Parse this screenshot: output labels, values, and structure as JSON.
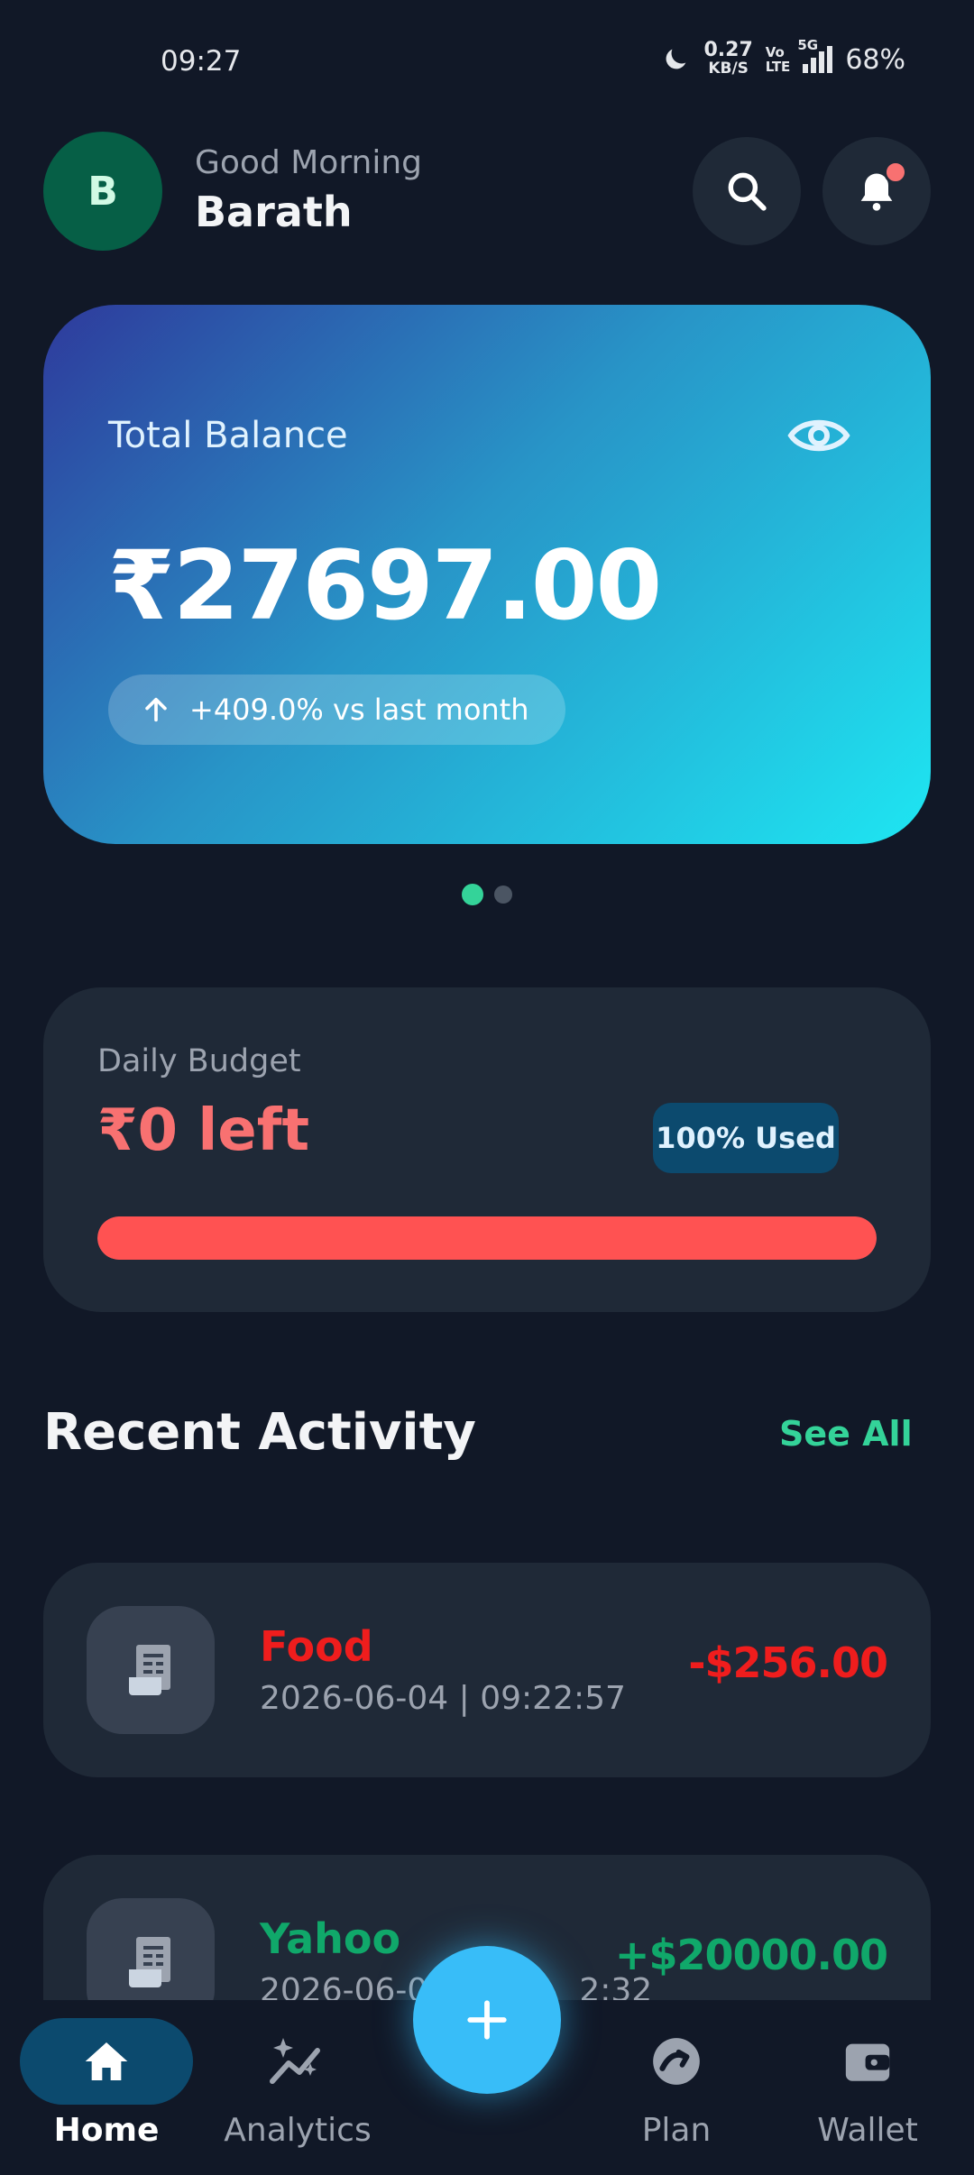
{
  "status_bar": {
    "time": "09:27",
    "net_speed": "0.27",
    "net_speed_unit": "KB/S",
    "volte_top": "Vo",
    "volte_bottom": "LTE",
    "network": "5G",
    "battery": "68%"
  },
  "header": {
    "avatar_initial": "B",
    "greeting": "Good Morning",
    "user_name": "Barath",
    "has_notification": true
  },
  "balance_card": {
    "label": "Total Balance",
    "amount": "₹27697.00",
    "trend_text": "+409.0% vs last month",
    "visibility_icon": "eye-icon"
  },
  "carousel": {
    "pages": 2,
    "active_index": 0
  },
  "budget": {
    "label": "Daily Budget",
    "remaining": "₹0 left",
    "used_badge": "100% Used",
    "used_fraction": 1.0
  },
  "recent": {
    "title": "Recent Activity",
    "see_all": "See All",
    "transactions": [
      {
        "name": "Food",
        "date": "2026-06-04 | 09:22:57",
        "amount": "-$256.00",
        "kind": "expense",
        "icon": "receipt-icon"
      },
      {
        "name": "Yahoo",
        "date": "2026-06-0",
        "date_tail": "2:32",
        "amount": "+$20000.00",
        "kind": "income",
        "icon": "receipt-icon"
      }
    ]
  },
  "nav": {
    "items": [
      {
        "label": "Home",
        "icon": "home-icon",
        "active": true
      },
      {
        "label": "Analytics",
        "icon": "analytics-icon",
        "active": false
      },
      {
        "label": "Plan",
        "icon": "plan-icon",
        "active": false
      },
      {
        "label": "Wallet",
        "icon": "wallet-icon",
        "active": false
      }
    ],
    "fab_icon": "plus-icon"
  },
  "colors": {
    "background": "#111827",
    "card": "#1f2937",
    "accent_green": "#34d399",
    "danger": "#ff5252",
    "fab": "#38bdf8"
  }
}
